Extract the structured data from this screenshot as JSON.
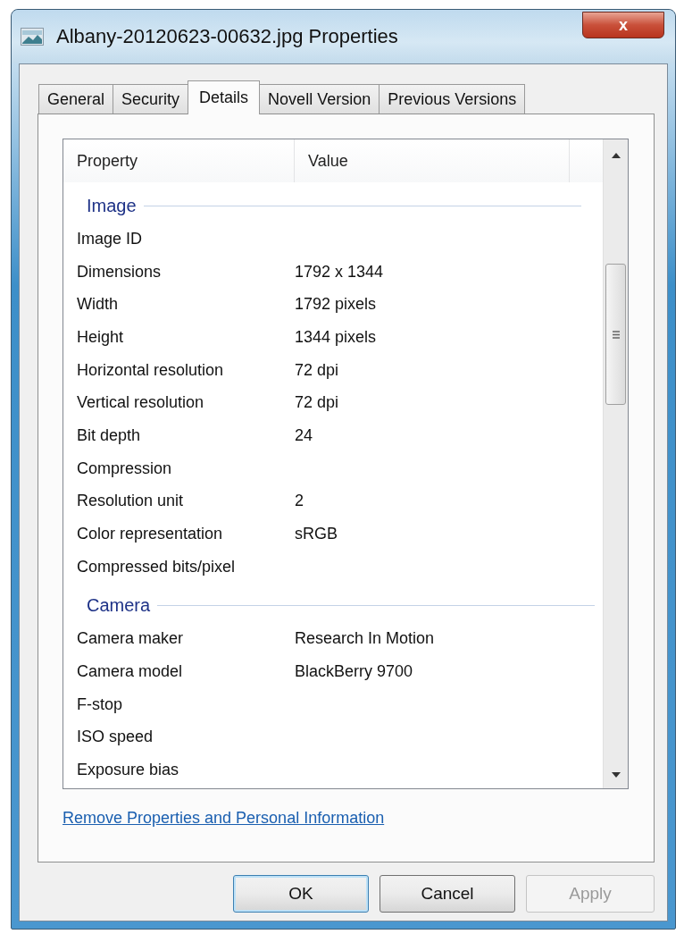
{
  "window": {
    "title": "Albany-20120623-00632.jpg Properties",
    "close_label": "x"
  },
  "tabs": [
    {
      "label": "General",
      "selected": false
    },
    {
      "label": "Security",
      "selected": false
    },
    {
      "label": "Details",
      "selected": true
    },
    {
      "label": "Novell Version",
      "selected": false
    },
    {
      "label": "Previous Versions",
      "selected": false
    }
  ],
  "table": {
    "columns": [
      "Property",
      "Value"
    ],
    "groups": [
      {
        "heading": "Image",
        "rows": [
          {
            "property": "Image ID",
            "value": ""
          },
          {
            "property": "Dimensions",
            "value": "1792 x 1344"
          },
          {
            "property": "Width",
            "value": "1792 pixels"
          },
          {
            "property": "Height",
            "value": "1344 pixels"
          },
          {
            "property": "Horizontal resolution",
            "value": "72 dpi"
          },
          {
            "property": "Vertical resolution",
            "value": "72 dpi"
          },
          {
            "property": "Bit depth",
            "value": "24"
          },
          {
            "property": "Compression",
            "value": ""
          },
          {
            "property": "Resolution unit",
            "value": "2"
          },
          {
            "property": "Color representation",
            "value": "sRGB"
          },
          {
            "property": "Compressed bits/pixel",
            "value": ""
          }
        ]
      },
      {
        "heading": "Camera",
        "rows": [
          {
            "property": "Camera maker",
            "value": "Research In Motion"
          },
          {
            "property": "Camera model",
            "value": "BlackBerry 9700"
          },
          {
            "property": "F-stop",
            "value": ""
          },
          {
            "property": "ISO speed",
            "value": ""
          },
          {
            "property": "Exposure bias",
            "value": ""
          }
        ]
      }
    ]
  },
  "link": "Remove Properties and Personal Information",
  "buttons": [
    {
      "label": "OK",
      "default": true,
      "disabled": false
    },
    {
      "label": "Cancel",
      "default": false,
      "disabled": false
    },
    {
      "label": "Apply",
      "default": false,
      "disabled": true
    }
  ]
}
